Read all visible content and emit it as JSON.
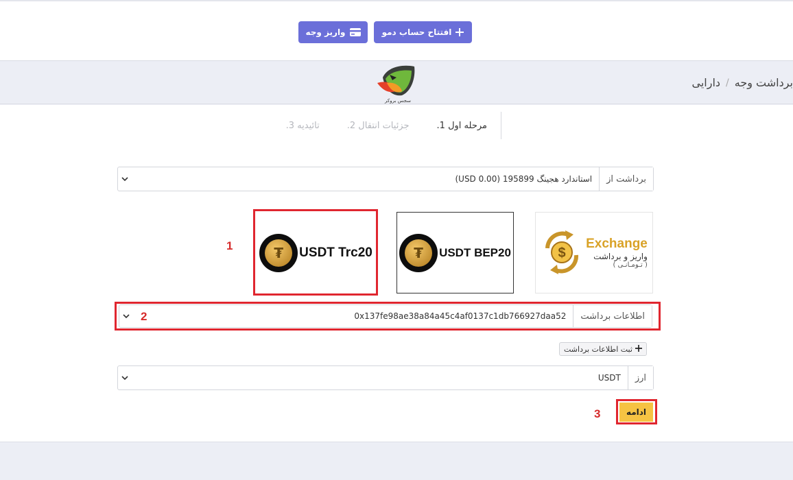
{
  "header": {
    "demo_button": "افتتاح حساب دمو",
    "deposit_button": "واریز وجه"
  },
  "breadcrumb": {
    "current": "برداشت وجه",
    "previous": "دارایی"
  },
  "logo": {
    "text": "سجس بروکر"
  },
  "steps": [
    {
      "label": "مرحله اول 1."
    },
    {
      "label": "جزئیات انتقال 2."
    },
    {
      "label": "تائیدیه 3."
    }
  ],
  "withdraw_from": {
    "label": "برداشت از",
    "value": "استاندارد هجینگ 195899 (USD 0.00)"
  },
  "methods": {
    "trc20": "USDT Trc20",
    "bep20": "USDT BEP20",
    "exchange_title": "Exchange",
    "exchange_sub": "واریز و برداشت",
    "exchange_sub2": "( تـومـانـی )"
  },
  "withdraw_info": {
    "label": "اطلاعات برداشت",
    "value": "0x137fe98ae38a84a45c4af0137c1db766927daa52"
  },
  "add_info_button": "ثبت اطلاعات برداشت",
  "currency": {
    "label": "ارز",
    "value": "USDT"
  },
  "continue_button": "ادامه",
  "annotations": {
    "n1": "1",
    "n2": "2",
    "n3": "3"
  },
  "colors": {
    "accent_purple": "#6b6fd9",
    "highlight_red": "#e0262f",
    "continue_yellow": "#f6c343",
    "usdt_gold": "#d9a227"
  }
}
